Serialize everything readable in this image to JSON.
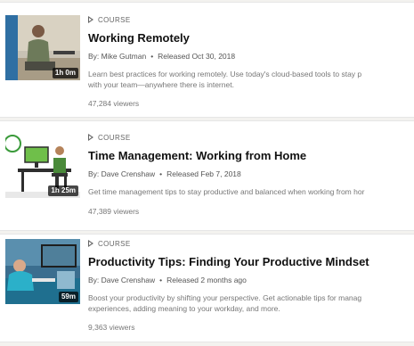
{
  "courses": [
    {
      "type": "COURSE",
      "title": "Working Remotely",
      "author": "By: Mike Gutman",
      "released": "Released Oct 30, 2018",
      "description_line1": "Learn best practices for working remotely. Use today's cloud-based tools to stay p",
      "description_line2": "with your team—anywhere there is internet.",
      "viewers": "47,284 viewers",
      "duration": "1h 0m"
    },
    {
      "type": "COURSE",
      "title": "Time Management: Working from Home",
      "author": "By: Dave Crenshaw",
      "released": "Released Feb 7, 2018",
      "description_line1": "Get time management tips to stay productive and balanced when working from hor",
      "viewers": "47,389 viewers",
      "duration": "1h 25m"
    },
    {
      "type": "COURSE",
      "title": "Productivity Tips: Finding Your Productive Mindset",
      "author": "By: Dave Crenshaw",
      "released": "Released 2 months ago",
      "description_line1": "Boost your productivity by shifting your perspective. Get actionable tips for manag",
      "description_line2": "experiences, adding meaning to your workday, and more.",
      "viewers": "9,363 viewers",
      "duration": "59m"
    }
  ],
  "separator": "•"
}
